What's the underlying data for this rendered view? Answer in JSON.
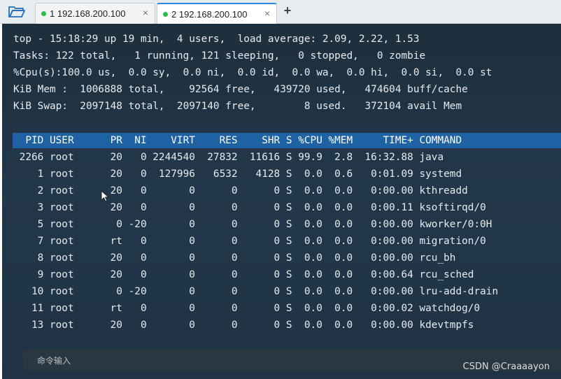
{
  "tabs": [
    {
      "label": "1 192.168.200.100",
      "active": false,
      "status_color": "#2dbe4a"
    },
    {
      "label": "2 192.168.200.100",
      "active": true,
      "status_color": "#2dbe4a"
    }
  ],
  "tab_close_label": "×",
  "new_tab_label": "+",
  "terminal": {
    "summary": [
      "top - 15:18:29 up 19 min,  4 users,  load average: 2.09, 2.22, 1.53",
      "Tasks: 122 total,   1 running, 121 sleeping,   0 stopped,   0 zombie",
      "%Cpu(s):100.0 us,  0.0 sy,  0.0 ni,  0.0 id,  0.0 wa,  0.0 hi,  0.0 si,  0.0 st",
      "KiB Mem :  1006888 total,    92564 free,   439720 used,   474604 buff/cache",
      "KiB Swap:  2097148 total,  2097140 free,        8 used.   372104 avail Mem"
    ],
    "header": "  PID USER      PR  NI    VIRT    RES    SHR S %CPU %MEM     TIME+ COMMAND",
    "processes": [
      " 2266 root      20   0 2244540  27832  11616 S 99.9  2.8  16:32.88 java",
      "    1 root      20   0  127996   6532   4128 S  0.0  0.6   0:01.09 systemd",
      "    2 root      20   0       0      0      0 S  0.0  0.0   0:00.00 kthreadd",
      "    3 root      20   0       0      0      0 S  0.0  0.0   0:00.11 ksoftirqd/0",
      "    5 root       0 -20       0      0      0 S  0.0  0.0   0:00.00 kworker/0:0H",
      "    7 root      rt   0       0      0      0 S  0.0  0.0   0:00.00 migration/0",
      "    8 root      20   0       0      0      0 S  0.0  0.0   0:00.00 rcu_bh",
      "    9 root      20   0       0      0      0 S  0.0  0.0   0:00.64 rcu_sched",
      "   10 root       0 -20       0      0      0 S  0.0  0.0   0:00.00 lru-add-drain",
      "   11 root      rt   0       0      0      0 S  0.0  0.0   0:00.02 watchdog/0",
      "   13 root      20   0       0      0      0 S  0.0  0.0   0:00.00 kdevtmpfs"
    ]
  },
  "command_input": {
    "placeholder": "命令输入"
  },
  "watermark": "CSDN @Craaaayon",
  "icons": {
    "folder": "folder-open-icon",
    "cursor": "mouse-pointer-icon"
  },
  "colors": {
    "terminal_bg": "#1f3344",
    "header_bar": "#1e62a3",
    "accent": "#2b8ae2"
  }
}
